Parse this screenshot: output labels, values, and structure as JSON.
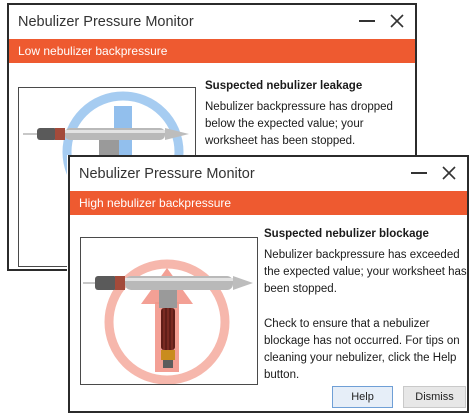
{
  "back_dialog": {
    "title": "Nebulizer Pressure Monitor",
    "banner": "Low nebulizer backpressure",
    "heading": "Suspected nebulizer leakage",
    "body": "Nebulizer backpressure has dropped below the expected value; your worksheet has been stopped.",
    "illustration_icon": "nebulizer-leak-icon"
  },
  "front_dialog": {
    "title": "Nebulizer Pressure Monitor",
    "banner": "High nebulizer backpressure",
    "heading": "Suspected nebulizer blockage",
    "body": "Nebulizer backpressure has exceeded the expected value; your worksheet has been stopped.",
    "body2": "Check to ensure that a nebulizer blockage has not occurred. For tips on cleaning your nebulizer, click the Help button.",
    "help_label": "Help",
    "dismiss_label": "Dismiss",
    "illustration_icon": "nebulizer-blockage-icon"
  },
  "window_controls": {
    "minimize_icon": "minimize-icon",
    "close_icon": "close-icon"
  },
  "colors": {
    "banner": "#ee5a30",
    "low_pressure_accent": "#5aa6e8",
    "high_pressure_accent": "#f08a7a",
    "help_button_border": "#6f9fd6"
  }
}
